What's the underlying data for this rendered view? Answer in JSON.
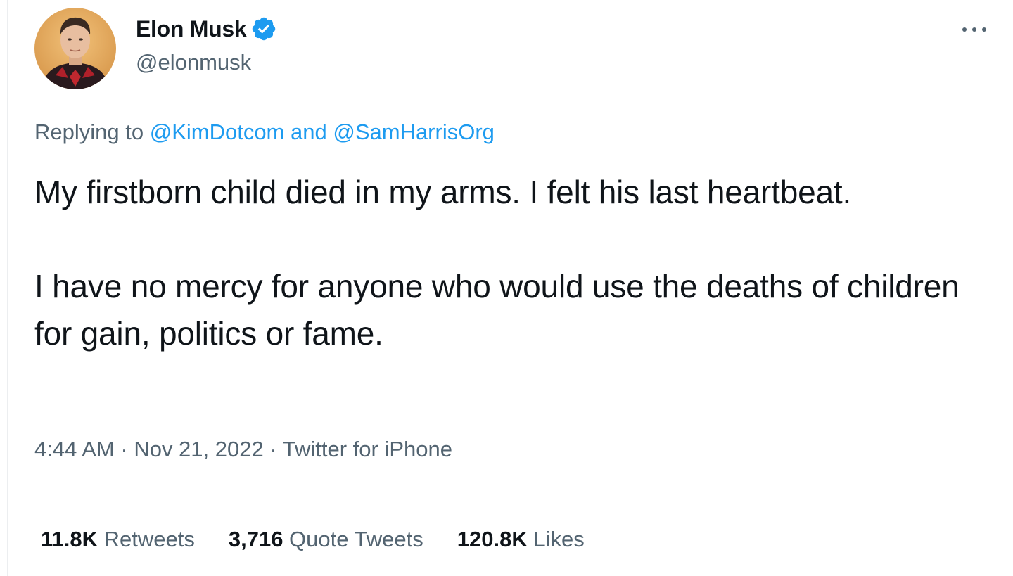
{
  "author": {
    "display_name": "Elon Musk",
    "handle": "@elonmusk",
    "verified": true,
    "verified_color": "#1d9bf0"
  },
  "reply_context": {
    "prefix": "Replying to ",
    "mentions": [
      "@KimDotcom",
      "@SamHarrisOrg"
    ],
    "conjunction": " and "
  },
  "tweet": {
    "paragraphs": [
      "My firstborn child died in my arms. I felt his last heartbeat.",
      "I have no mercy for anyone who would use the deaths of children for gain, politics or fame."
    ]
  },
  "meta": {
    "time": "4:44 AM",
    "separator": " · ",
    "date": "Nov 21, 2022",
    "source": "Twitter for iPhone"
  },
  "stats": {
    "retweets": {
      "count": "11.8K",
      "label": " Retweets"
    },
    "quote_tweets": {
      "count": "3,716",
      "label": " Quote Tweets"
    },
    "likes": {
      "count": "120.8K",
      "label": " Likes"
    }
  },
  "icons": {
    "more": "more-horizontal-icon",
    "verified": "verified-badge-icon"
  },
  "colors": {
    "accent": "#1d9bf0",
    "text_primary": "#0f1419",
    "text_secondary": "#536471"
  }
}
